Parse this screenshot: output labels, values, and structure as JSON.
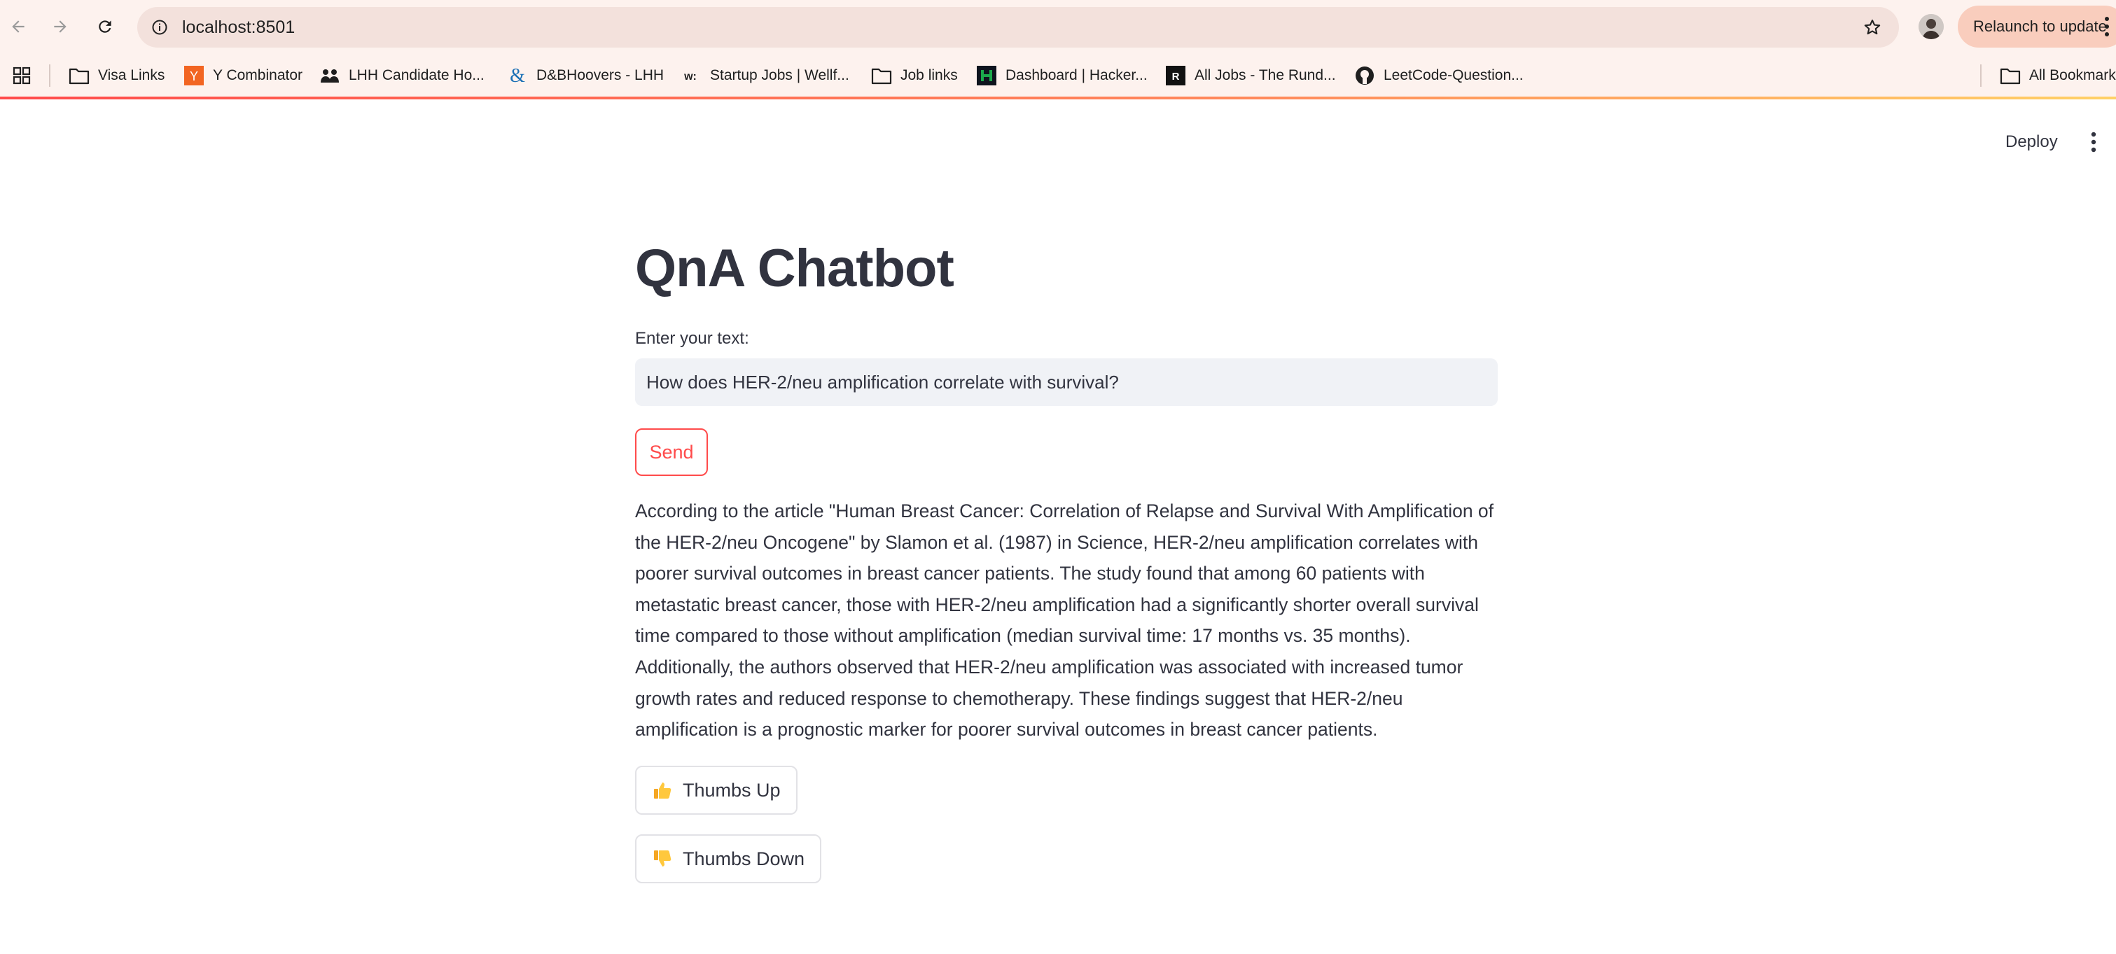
{
  "browser": {
    "url": "localhost:8501",
    "relaunch_label": "Relaunch to update",
    "bookmarks": [
      {
        "label": "Visa Links",
        "icon": "folder-icon"
      },
      {
        "label": "Y Combinator",
        "icon": "ycombinator-icon"
      },
      {
        "label": "LHH Candidate Ho...",
        "icon": "people-icon"
      },
      {
        "label": "D&BHoovers - LHH",
        "icon": "dnb-icon"
      },
      {
        "label": "Startup Jobs | Wellf...",
        "icon": "wellfound-icon"
      },
      {
        "label": "Job links",
        "icon": "folder-icon"
      },
      {
        "label": "Dashboard | Hacker...",
        "icon": "hackerrank-icon"
      },
      {
        "label": "All Jobs - The Rund...",
        "icon": "rundown-icon"
      },
      {
        "label": "LeetCode-Question...",
        "icon": "github-icon"
      }
    ],
    "all_bookmarks_label": "All Bookmark"
  },
  "header": {
    "deploy_label": "Deploy"
  },
  "main": {
    "title": "QnA Chatbot",
    "input_label": "Enter your text:",
    "input_value": "How does HER-2/neu amplification correlate with survival?",
    "send_label": "Send",
    "answer": "According to the article \"Human Breast Cancer: Correlation of Relapse and Survival With Amplification of the HER-2/neu Oncogene\" by Slamon et al. (1987) in Science, HER-2/neu amplification correlates with poorer survival outcomes in breast cancer patients. The study found that among 60 patients with metastatic breast cancer, those with HER-2/neu amplification had a significantly shorter overall survival time compared to those without amplification (median survival time: 17 months vs. 35 months). Additionally, the authors observed that HER-2/neu amplification was associated with increased tumor growth rates and reduced response to chemotherapy. These findings suggest that HER-2/neu amplification is a prognostic marker for poorer survival outcomes in breast cancer patients.",
    "thumbs_up_label": "Thumbs Up",
    "thumbs_down_label": "Thumbs Down"
  },
  "colors": {
    "accent": "#ff4b4b",
    "text": "#31333f",
    "input_bg": "#f0f2f6"
  }
}
